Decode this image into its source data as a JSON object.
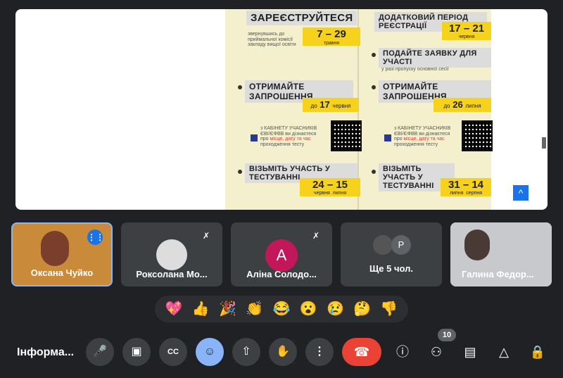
{
  "presentation": {
    "left": {
      "register_title": "ЗАРЕЄСТРУЙТЕСЯ",
      "register_desc": "звернувшись до приймальної комісії закладу вищої освіти",
      "register_dates": "7 – 29",
      "register_month": "травня",
      "invite_title": "ОТРИМАЙТЕ ЗАПРОШЕННЯ",
      "invite_prefix": "до",
      "invite_day": "17",
      "invite_month": "червня",
      "cabinet_text": "з КАБІНЕТУ УЧАСНИКІВ ЄВІ/ЄФВВ ви дізнаєтеся про",
      "cabinet_highlight": "місце, дату та час",
      "cabinet_suffix": "проходження тесту",
      "test_title": "ВІЗЬМІТЬ УЧАСТЬ У ТЕСТУВАННІ",
      "test_dates": "24 – 15",
      "test_month_a": "червня",
      "test_month_b": "липня"
    },
    "right": {
      "extra_title": "ДОДАТКОВИЙ ПЕРІОД РЕЄСТРАЦІЇ",
      "extra_dates": "17 – 21",
      "extra_month": "червня",
      "apply_title": "ПОДАЙТЕ ЗАЯВКУ ДЛЯ УЧАСТІ",
      "apply_desc": "у разі пропуску основної сесії",
      "invite_title": "ОТРИМАЙТЕ ЗАПРОШЕННЯ",
      "invite_prefix": "до",
      "invite_day": "26",
      "invite_month": "липня",
      "cabinet_text": "з КАБІНЕТУ УЧАСНИКІВ ЄВІ/ЄФВВ ви дізнаєтеся про",
      "cabinet_highlight": "місце, дату та час",
      "cabinet_suffix": "проходження тесту",
      "test_title": "ВІЗЬМІТЬ УЧАСТЬ У ТЕСТУВАННІ",
      "test_dates": "31 – 14",
      "test_month_a": "липня",
      "test_month_b": "серпня"
    }
  },
  "participants": [
    {
      "name": "Оксана Чуйко",
      "speaking": true
    },
    {
      "name": "Роксолана Мо...",
      "muted": true
    },
    {
      "name": "Аліна Солодо...",
      "muted": true,
      "initial": "А"
    },
    {
      "name": "Ще 5 чол.",
      "initial": "P"
    },
    {
      "name": "Галина Федор..."
    }
  ],
  "reactions": [
    "💖",
    "👍",
    "🎉",
    "👏",
    "😂",
    "😮",
    "😢",
    "🤔",
    "👎"
  ],
  "meeting": {
    "title": "Інформа..."
  },
  "controls": {
    "people_count": "10"
  },
  "colors": {
    "accent": "#8ab4f8",
    "end_call": "#ea4335",
    "highlight_yellow": "#f7d21c",
    "speaking_border": "#8ab4f8"
  }
}
